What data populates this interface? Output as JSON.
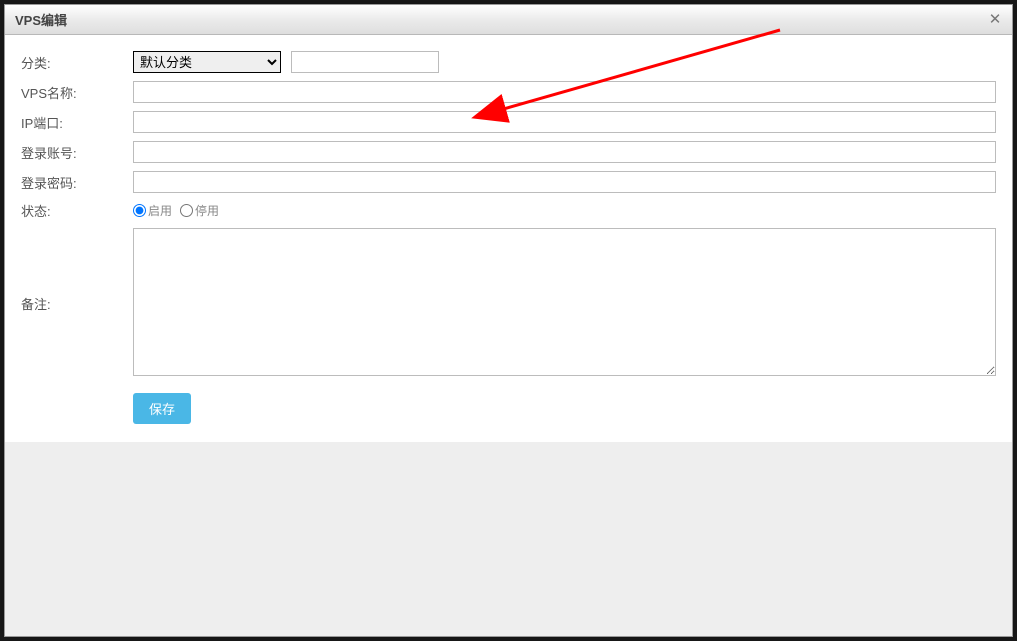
{
  "dialog": {
    "title": "VPS编辑"
  },
  "form": {
    "labels": {
      "category": "分类:",
      "vps_name": "VPS名称:",
      "ip_port": "IP端口:",
      "login_account": "登录账号:",
      "login_password": "登录密码:",
      "status": "状态:",
      "remark": "备注:"
    },
    "category_selected": "默认分类",
    "category_extra_value": "",
    "vps_name_value": "",
    "ip_port_value": "",
    "login_account_value": "",
    "login_password_value": "",
    "status_options": {
      "enable": "启用",
      "disable": "停用"
    },
    "status_selected": "enable",
    "remark_value": "",
    "save_label": "保存"
  }
}
